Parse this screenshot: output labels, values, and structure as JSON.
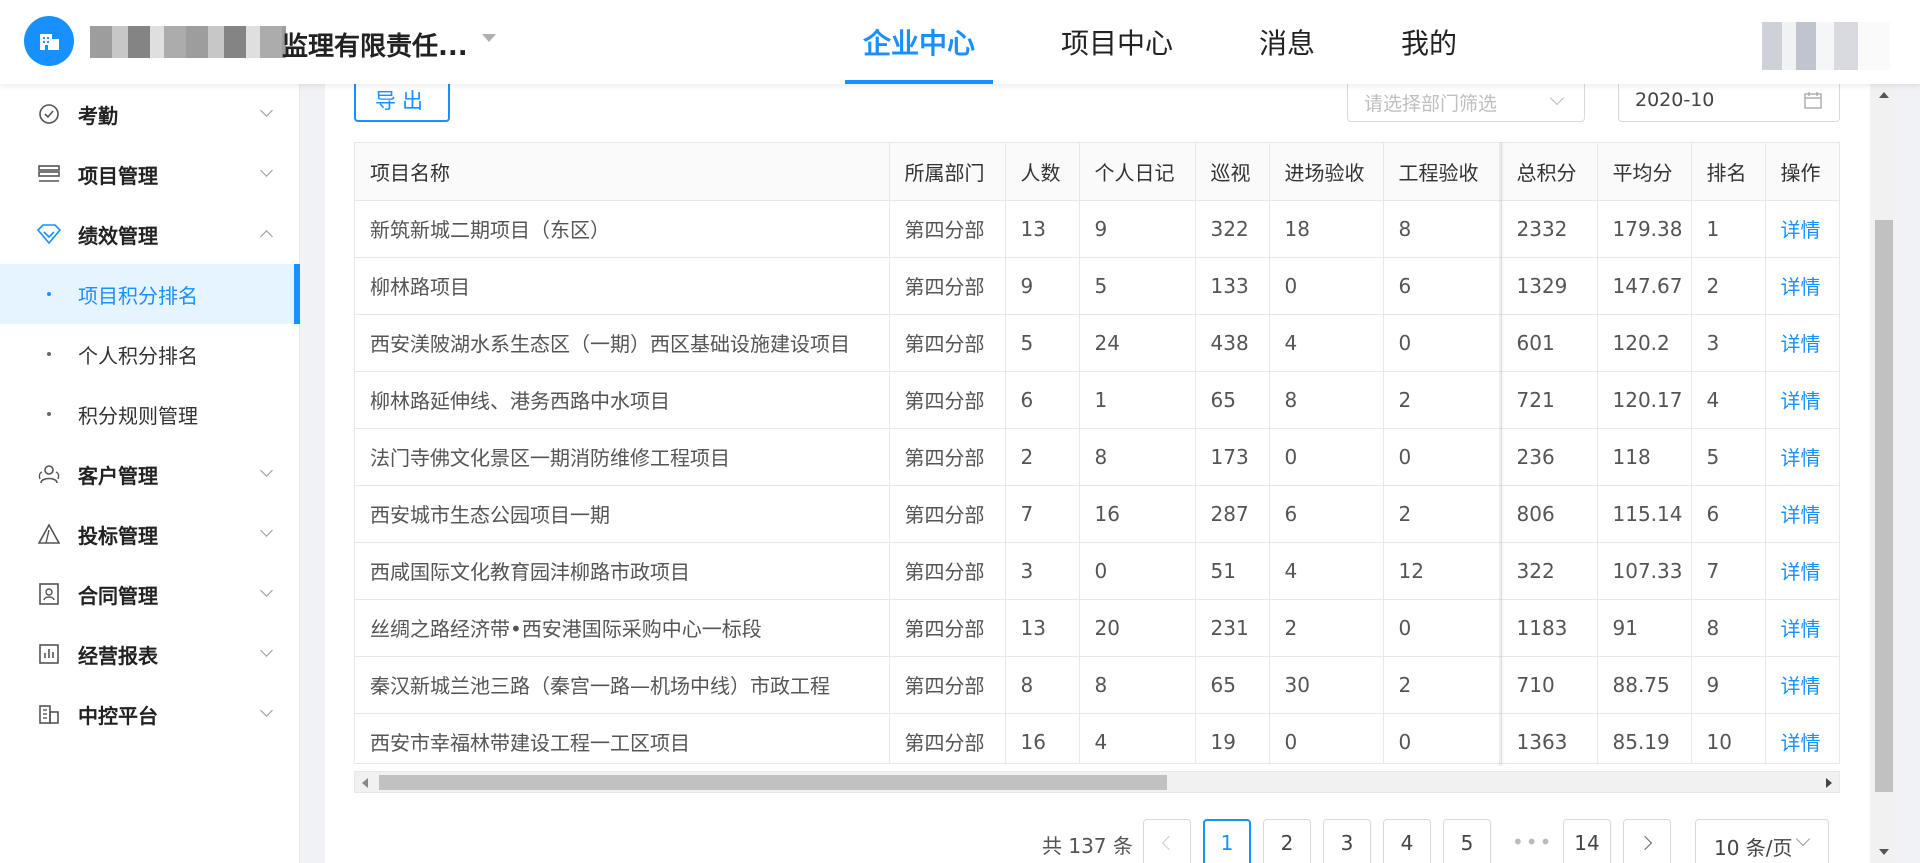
{
  "header": {
    "company_name": "监理有限责任...",
    "nav": [
      "企业中心",
      "项目中心",
      "消息",
      "我的"
    ],
    "active_nav": "企业中心"
  },
  "sidebar": {
    "menus": [
      {
        "label": "考勤",
        "icon": "check-circle-icon",
        "expanded": false
      },
      {
        "label": "项目管理",
        "icon": "list-icon",
        "expanded": false
      },
      {
        "label": "绩效管理",
        "icon": "diamond-icon",
        "expanded": true
      },
      {
        "label": "客户管理",
        "icon": "users-icon",
        "expanded": false
      },
      {
        "label": "投标管理",
        "icon": "triangle-icon",
        "expanded": false
      },
      {
        "label": "合同管理",
        "icon": "contract-icon",
        "expanded": false
      },
      {
        "label": "经营报表",
        "icon": "bar-chart-icon",
        "expanded": false
      },
      {
        "label": "中控平台",
        "icon": "building-icon",
        "expanded": false
      }
    ],
    "sub_items": [
      "项目积分排名",
      "个人积分排名",
      "积分规则管理"
    ],
    "active_sub": "项目积分排名"
  },
  "toolbar": {
    "export_label": "导出",
    "dept_placeholder": "请选择部门筛选",
    "month_value": "2020-10"
  },
  "table": {
    "headers": [
      "项目名称",
      "所属部门",
      "人数",
      "个人日记",
      "巡视",
      "进场验收",
      "工程验收",
      "总积分",
      "平均分",
      "排名",
      "操作"
    ],
    "rows": [
      [
        "新筑新城二期项目（东区）",
        "第四分部",
        "13",
        "9",
        "322",
        "18",
        "8",
        "2332",
        "179.38",
        "1",
        "详情"
      ],
      [
        "柳林路项目",
        "第四分部",
        "9",
        "5",
        "133",
        "0",
        "6",
        "1329",
        "147.67",
        "2",
        "详情"
      ],
      [
        "西安渼陂湖水系生态区（一期）西区基础设施建设项目",
        "第四分部",
        "5",
        "24",
        "438",
        "4",
        "0",
        "601",
        "120.2",
        "3",
        "详情"
      ],
      [
        "柳林路延伸线、港务西路中水项目",
        "第四分部",
        "6",
        "1",
        "65",
        "8",
        "2",
        "721",
        "120.17",
        "4",
        "详情"
      ],
      [
        "法门寺佛文化景区一期消防维修工程项目",
        "第四分部",
        "2",
        "8",
        "173",
        "0",
        "0",
        "236",
        "118",
        "5",
        "详情"
      ],
      [
        "西安城市生态公园项目一期",
        "第四分部",
        "7",
        "16",
        "287",
        "6",
        "2",
        "806",
        "115.14",
        "6",
        "详情"
      ],
      [
        "西咸国际文化教育园沣柳路市政项目",
        "第四分部",
        "3",
        "0",
        "51",
        "4",
        "12",
        "322",
        "107.33",
        "7",
        "详情"
      ],
      [
        "丝绸之路经济带•西安港国际采购中心一标段",
        "第四分部",
        "13",
        "20",
        "231",
        "2",
        "0",
        "1183",
        "91",
        "8",
        "详情"
      ],
      [
        "秦汉新城兰池三路（秦宫一路—机场中线）市政工程",
        "第四分部",
        "8",
        "8",
        "65",
        "30",
        "2",
        "710",
        "88.75",
        "9",
        "详情"
      ],
      [
        "西安市幸福林带建设工程一工区项目",
        "第四分部",
        "16",
        "4",
        "19",
        "0",
        "0",
        "1363",
        "85.19",
        "10",
        "详情"
      ]
    ]
  },
  "pagination": {
    "total_text": "共 137 条",
    "pages": [
      "1",
      "2",
      "3",
      "4",
      "5"
    ],
    "ellipsis": "•••",
    "last_page": "14",
    "current": "1",
    "page_size": "10 条/页"
  },
  "colors": {
    "accent": "#1890ff",
    "active_bg": "#e6f4ff"
  }
}
